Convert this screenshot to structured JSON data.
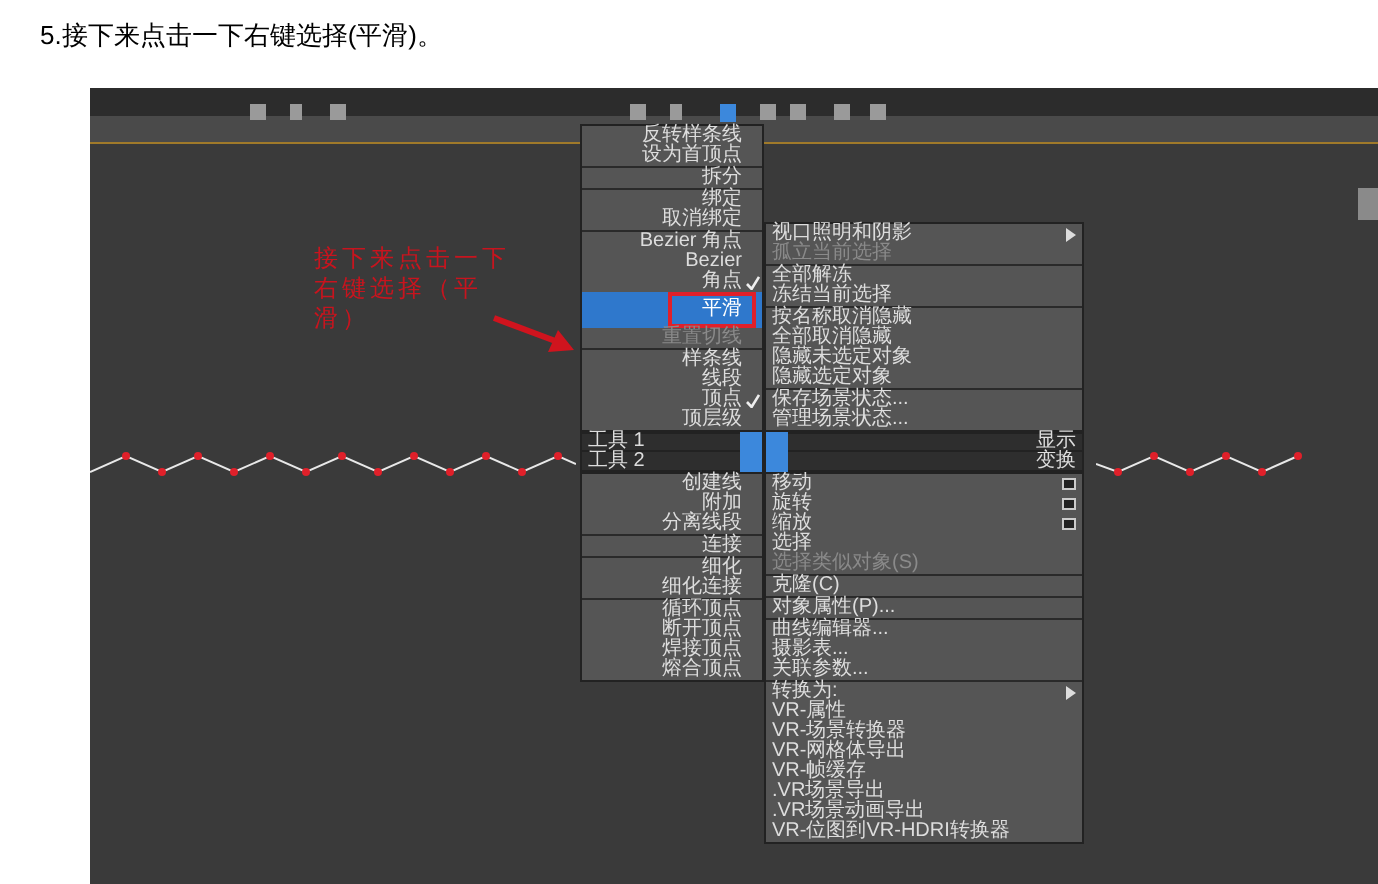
{
  "heading": "5.接下来点击一下右键选择(平滑)。",
  "annotation": "接下来点击一下右键选择（平滑）",
  "quad_menu": {
    "top_left": [
      [
        {
          "label": "反转样条线",
          "checked": false,
          "disabled": false,
          "selected": false
        },
        {
          "label": "设为首顶点",
          "checked": false,
          "disabled": false,
          "selected": false
        }
      ],
      [
        {
          "label": "拆分",
          "checked": false,
          "disabled": false,
          "selected": false
        }
      ],
      [
        {
          "label": "绑定",
          "checked": false,
          "disabled": false,
          "selected": false
        },
        {
          "label": "取消绑定",
          "checked": false,
          "disabled": false,
          "selected": false
        }
      ],
      [
        {
          "label": "Bezier 角点",
          "checked": false,
          "disabled": false,
          "selected": false
        },
        {
          "label": "Bezier",
          "checked": false,
          "disabled": false,
          "selected": false
        },
        {
          "label": "角点",
          "checked": true,
          "disabled": false,
          "selected": false
        },
        {
          "label": "平滑",
          "checked": false,
          "disabled": false,
          "selected": true
        },
        {
          "label": "重置切线",
          "checked": false,
          "disabled": true,
          "selected": false
        }
      ],
      [
        {
          "label": "样条线",
          "checked": false,
          "disabled": false,
          "selected": false
        },
        {
          "label": "线段",
          "checked": false,
          "disabled": false,
          "selected": false
        },
        {
          "label": "顶点",
          "checked": true,
          "disabled": false,
          "selected": false
        },
        {
          "label": "顶层级",
          "checked": false,
          "disabled": false,
          "selected": false
        }
      ]
    ],
    "top_right": [
      [
        {
          "label": "视口照明和阴影",
          "kind": "submenu",
          "checked": false,
          "disabled": false,
          "selected": false
        },
        {
          "label": "孤立当前选择",
          "kind": "plain",
          "checked": false,
          "disabled": true,
          "selected": false
        }
      ],
      [
        {
          "label": "全部解冻",
          "kind": "plain",
          "checked": false,
          "disabled": false,
          "selected": false
        },
        {
          "label": "冻结当前选择",
          "kind": "plain",
          "checked": false,
          "disabled": false,
          "selected": false
        }
      ],
      [
        {
          "label": "按名称取消隐藏",
          "kind": "plain",
          "checked": false,
          "disabled": false,
          "selected": false
        },
        {
          "label": "全部取消隐藏",
          "kind": "plain",
          "checked": false,
          "disabled": false,
          "selected": false
        },
        {
          "label": "隐藏未选定对象",
          "kind": "plain",
          "checked": false,
          "disabled": false,
          "selected": false
        },
        {
          "label": "隐藏选定对象",
          "kind": "plain",
          "checked": false,
          "disabled": false,
          "selected": false
        }
      ],
      [
        {
          "label": "保存场景状态...",
          "kind": "plain",
          "checked": false,
          "disabled": false,
          "selected": false
        },
        {
          "label": "管理场景状态...",
          "kind": "plain",
          "checked": false,
          "disabled": false,
          "selected": false
        }
      ]
    ],
    "header_rows": [
      {
        "left": "工具 1",
        "right": "显示"
      },
      {
        "left": "工具 2",
        "right": "变换"
      }
    ],
    "bottom_left": [
      [
        {
          "label": "创建线",
          "checked": false,
          "disabled": false,
          "selected": false
        },
        {
          "label": "附加",
          "checked": false,
          "disabled": false,
          "selected": false
        },
        {
          "label": "分离线段",
          "checked": false,
          "disabled": false,
          "selected": false
        }
      ],
      [
        {
          "label": "连接",
          "checked": false,
          "disabled": false,
          "selected": false
        }
      ],
      [
        {
          "label": "细化",
          "checked": false,
          "disabled": false,
          "selected": false
        },
        {
          "label": "细化连接",
          "checked": false,
          "disabled": false,
          "selected": false
        }
      ],
      [
        {
          "label": "循环顶点",
          "checked": false,
          "disabled": false,
          "selected": false
        },
        {
          "label": "断开顶点",
          "checked": false,
          "disabled": false,
          "selected": false
        },
        {
          "label": "焊接顶点",
          "checked": false,
          "disabled": false,
          "selected": false
        },
        {
          "label": "熔合顶点",
          "checked": false,
          "disabled": false,
          "selected": false
        }
      ]
    ],
    "bottom_right": [
      [
        {
          "label": "移动",
          "kind": "options",
          "checked": false,
          "disabled": false,
          "selected": false
        },
        {
          "label": "旋转",
          "kind": "options",
          "checked": false,
          "disabled": false,
          "selected": false
        },
        {
          "label": "缩放",
          "kind": "options",
          "checked": false,
          "disabled": false,
          "selected": false
        },
        {
          "label": "选择",
          "kind": "plain",
          "checked": false,
          "disabled": false,
          "selected": false
        },
        {
          "label": "选择类似对象(S)",
          "kind": "plain",
          "checked": false,
          "disabled": true,
          "selected": false
        }
      ],
      [
        {
          "label": "克隆(C)",
          "kind": "plain",
          "checked": false,
          "disabled": false,
          "selected": false
        }
      ],
      [
        {
          "label": "对象属性(P)...",
          "kind": "plain",
          "checked": false,
          "disabled": false,
          "selected": false
        }
      ],
      [
        {
          "label": "曲线编辑器...",
          "kind": "plain",
          "checked": false,
          "disabled": false,
          "selected": false
        },
        {
          "label": "摄影表...",
          "kind": "plain",
          "checked": false,
          "disabled": false,
          "selected": false
        },
        {
          "label": "关联参数...",
          "kind": "plain",
          "checked": false,
          "disabled": false,
          "selected": false
        }
      ],
      [
        {
          "label": "转换为:",
          "kind": "submenu",
          "checked": false,
          "disabled": false,
          "selected": false
        },
        {
          "label": "VR-属性",
          "kind": "plain",
          "checked": false,
          "disabled": false,
          "selected": false
        },
        {
          "label": "VR-场景转换器",
          "kind": "plain",
          "checked": false,
          "disabled": false,
          "selected": false
        },
        {
          "label": "VR-网格体导出",
          "kind": "plain",
          "checked": false,
          "disabled": false,
          "selected": false
        },
        {
          "label": "VR-帧缓存",
          "kind": "plain",
          "checked": false,
          "disabled": false,
          "selected": false
        },
        {
          "label": ".VR场景导出",
          "kind": "plain",
          "checked": false,
          "disabled": false,
          "selected": false
        },
        {
          "label": ".VR场景动画导出",
          "kind": "plain",
          "checked": false,
          "disabled": false,
          "selected": false
        },
        {
          "label": "VR-位图到VR-HDRI转换器",
          "kind": "plain",
          "checked": false,
          "disabled": false,
          "selected": false
        }
      ]
    ]
  }
}
